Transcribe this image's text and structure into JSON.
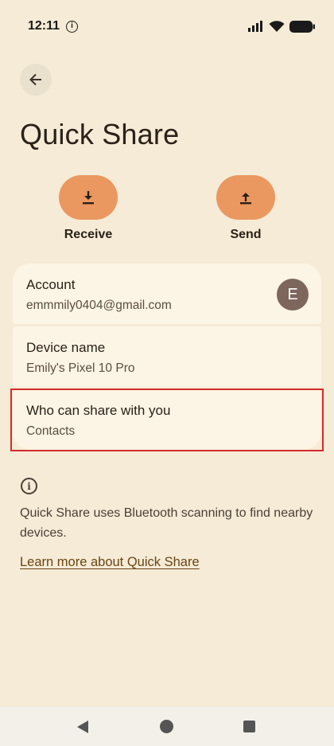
{
  "status": {
    "time": "12:11",
    "info_glyph": "i"
  },
  "header": {
    "title": "Quick Share"
  },
  "actions": {
    "receive_label": "Receive",
    "send_label": "Send"
  },
  "settings": {
    "account": {
      "title": "Account",
      "value": "emmmily0404@gmail.com",
      "avatar_letter": "E"
    },
    "device": {
      "title": "Device name",
      "value": "Emily's Pixel 10 Pro"
    },
    "visibility": {
      "title": "Who can share with you",
      "value": "Contacts"
    }
  },
  "info": {
    "glyph": "i",
    "text": "Quick Share uses Bluetooth scanning to find nearby devices.",
    "link": "Learn more about Quick Share"
  },
  "icons": {
    "back": "arrow-left-icon",
    "receive": "download-icon",
    "send": "upload-icon",
    "info": "info-icon"
  },
  "colors": {
    "background": "#f5ebd6",
    "card": "#fcf4e4",
    "accent": "#ea9860",
    "highlight": "#d52b2b",
    "link": "#6a4514"
  }
}
